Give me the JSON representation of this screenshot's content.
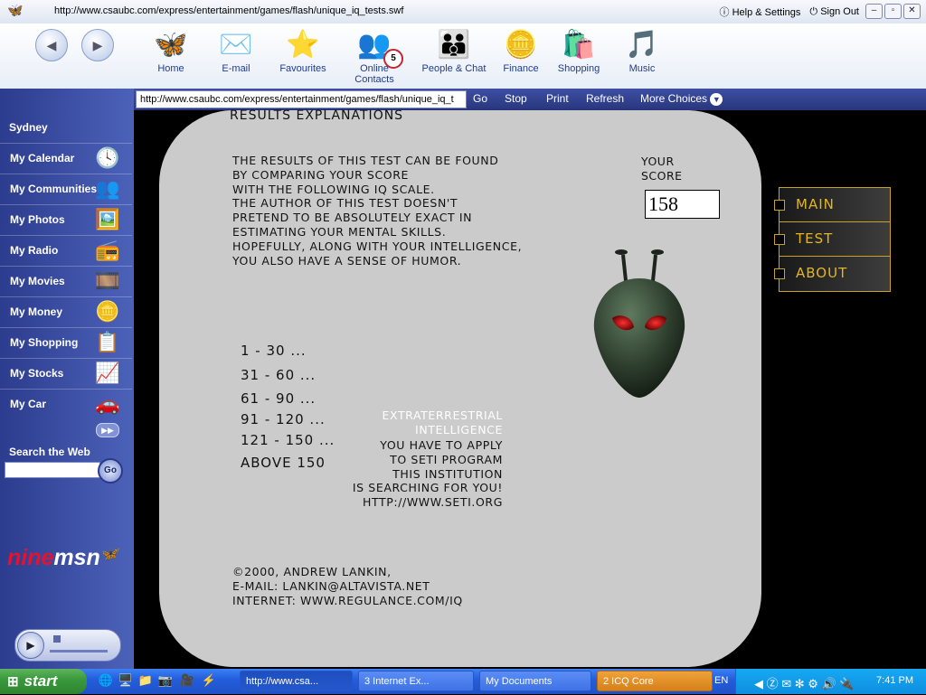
{
  "browser": {
    "url": "http://www.csaubc.com/express/entertainment/games/flash/unique_iq_tests.swf",
    "help_label": "Help & Settings",
    "signout_label": "Sign Out",
    "toolbar": [
      "Home",
      "E-mail",
      "Favourites",
      "Online Contacts",
      "People & Chat",
      "Finance",
      "Shopping",
      "Music"
    ],
    "contacts_badge": "5",
    "address_value": "http://www.csaubc.com/express/entertainment/games/flash/unique_iq_t",
    "commands": [
      "Go",
      "Stop",
      "Print",
      "Refresh",
      "More Choices"
    ]
  },
  "sidebar": {
    "city": "Sydney",
    "items": [
      "My Calendar",
      "My Communities",
      "My Photos",
      "My Radio",
      "My Movies",
      "My Money",
      "My Shopping",
      "My Stocks",
      "My Car"
    ],
    "search_label": "Search the Web",
    "go_label": "Go",
    "logo_nine": "nine",
    "logo_msn": "msn"
  },
  "flash": {
    "title": "RESULTS EXPLANATIONS",
    "explanation": [
      "THE RESULTS OF THIS TEST CAN BE FOUND",
      "BY COMPARING YOUR SCORE",
      "WITH THE FOLLOWING IQ SCALE.",
      "THE AUTHOR OF THIS TEST DOESN'T",
      "PRETEND TO BE ABSOLUTELY EXACT IN",
      "ESTIMATING YOUR MENTAL SKILLS.",
      "HOPEFULLY, ALONG WITH YOUR INTELLIGENCE,",
      "YOU ALSO HAVE A SENSE OF HUMOR."
    ],
    "score_label": [
      "YOUR",
      "SCORE"
    ],
    "score_value": "158",
    "scale": [
      "1 - 30 ...",
      "31 - 60 ...",
      "61 - 90 ...",
      "91 - 120 ...",
      "121 - 150 ...",
      "ABOVE 150"
    ],
    "et_title": [
      "EXTRATERRESTRIAL",
      "INTELLIGENCE"
    ],
    "et_text": [
      "YOU HAVE TO APPLY",
      "TO SETI PROGRAM",
      "THIS INSTITUTION",
      "IS SEARCHING FOR YOU!",
      "HTTP://WWW.SETI.ORG"
    ],
    "credits": [
      "©2000, ANDREW LANKIN,",
      "E-MAIL: LANKIN@ALTAVISTA.NET",
      "INTERNET: WWW.REGULANCE.COM/IQ"
    ],
    "menu": [
      "MAIN",
      "TEST",
      "ABOUT"
    ]
  },
  "taskbar": {
    "start_label": "start",
    "tasks": [
      "http://www.csa...",
      "3 Internet Ex...",
      "My Documents",
      "2 ICQ Core"
    ],
    "lang": "EN",
    "clock": "7:41 PM"
  }
}
